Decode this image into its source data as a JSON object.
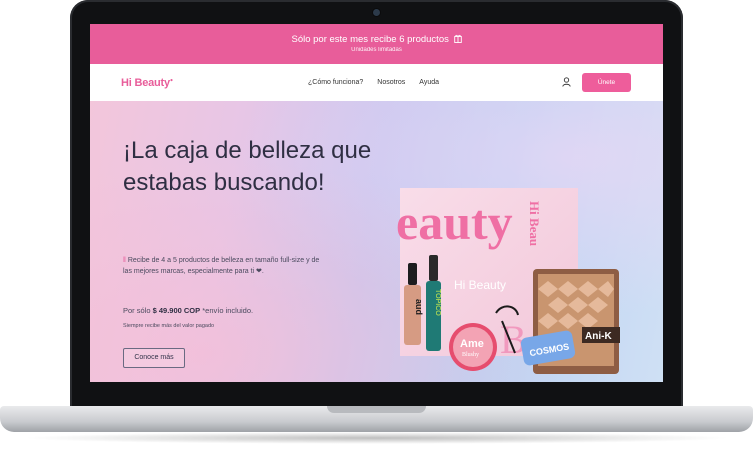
{
  "promo": {
    "line1": "Sólo por este mes recibe 6 productos",
    "line2": "Unidades limitadas"
  },
  "nav": {
    "logo": "Hi Beauty",
    "items": [
      "¿Cómo funciona?",
      "Nosotros",
      "Ayuda"
    ],
    "cta": "Únete"
  },
  "hero": {
    "title": "¡La caja de belleza que estabas buscando!",
    "description": "Recibe de 4 a 5 productos de belleza en tamaño full-size y de las mejores marcas, especialmente para ti ❤.",
    "price_prefix": "Por sólo",
    "price": "$ 49.900 COP",
    "price_suffix": "*envío incluido.",
    "note": "Siempre recibe más del valor pagado",
    "button": "Conoce más"
  },
  "product_labels": {
    "box_text": "eauty",
    "box_side": "Hi Beau",
    "box_logo": "Hi Beauty",
    "box_letter": "B",
    "tube": "aud",
    "mascara": "TOPICO",
    "blush": "Ame",
    "blush_sub": "Blushy",
    "palette": "Ani-K",
    "cosmos": "COSMOS"
  },
  "colors": {
    "brand_pink": "#e85d9a",
    "text_dark": "#2f2f43"
  }
}
